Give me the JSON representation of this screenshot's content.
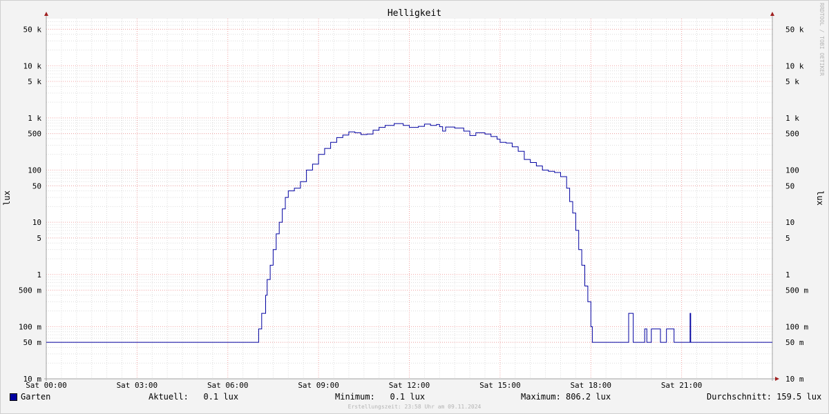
{
  "chart_data": {
    "type": "line",
    "title": "Helligkeit",
    "ylabel": "lux",
    "ylabel_right": "lux",
    "yscale": "log",
    "ylim": [
      0.01,
      80000
    ],
    "yticks": [
      {
        "value": 50000,
        "label": "50 k"
      },
      {
        "value": 10000,
        "label": "10 k"
      },
      {
        "value": 5000,
        "label": "5 k"
      },
      {
        "value": 1000,
        "label": "1 k"
      },
      {
        "value": 500,
        "label": "500"
      },
      {
        "value": 100,
        "label": "100"
      },
      {
        "value": 50,
        "label": "50"
      },
      {
        "value": 10,
        "label": "10"
      },
      {
        "value": 5,
        "label": "5"
      },
      {
        "value": 1,
        "label": "1"
      },
      {
        "value": 0.5,
        "label": "500 m"
      },
      {
        "value": 0.1,
        "label": "100 m"
      },
      {
        "value": 0.05,
        "label": "50 m"
      },
      {
        "value": 0.01,
        "label": "10 m"
      }
    ],
    "xlim_hours": [
      0,
      24
    ],
    "xticks": [
      {
        "hour": 0,
        "label": "Sat 00:00"
      },
      {
        "hour": 3,
        "label": "Sat 03:00"
      },
      {
        "hour": 6,
        "label": "Sat 06:00"
      },
      {
        "hour": 9,
        "label": "Sat 09:00"
      },
      {
        "hour": 12,
        "label": "Sat 12:00"
      },
      {
        "hour": 15,
        "label": "Sat 15:00"
      },
      {
        "hour": 18,
        "label": "Sat 18:00"
      },
      {
        "hour": 21,
        "label": "Sat 21:00"
      }
    ],
    "grid": true,
    "series": [
      {
        "name": "Garten",
        "color": "#0000a0",
        "points": [
          [
            0,
            0.05
          ],
          [
            7.0,
            0.05
          ],
          [
            7.02,
            0.09
          ],
          [
            7.1,
            0.09
          ],
          [
            7.12,
            0.18
          ],
          [
            7.2,
            0.18
          ],
          [
            7.25,
            0.4
          ],
          [
            7.3,
            0.8
          ],
          [
            7.4,
            1.5
          ],
          [
            7.5,
            3
          ],
          [
            7.6,
            6
          ],
          [
            7.7,
            10
          ],
          [
            7.8,
            18
          ],
          [
            7.9,
            30
          ],
          [
            8.0,
            40
          ],
          [
            8.2,
            45
          ],
          [
            8.4,
            60
          ],
          [
            8.6,
            100
          ],
          [
            8.8,
            130
          ],
          [
            9.0,
            200
          ],
          [
            9.2,
            260
          ],
          [
            9.4,
            340
          ],
          [
            9.6,
            420
          ],
          [
            9.8,
            470
          ],
          [
            10.0,
            540
          ],
          [
            10.2,
            520
          ],
          [
            10.4,
            480
          ],
          [
            10.6,
            490
          ],
          [
            10.8,
            580
          ],
          [
            11.0,
            660
          ],
          [
            11.2,
            720
          ],
          [
            11.5,
            780
          ],
          [
            11.8,
            720
          ],
          [
            12.0,
            660
          ],
          [
            12.3,
            690
          ],
          [
            12.5,
            760
          ],
          [
            12.7,
            720
          ],
          [
            12.9,
            750
          ],
          [
            13.0,
            680
          ],
          [
            13.1,
            560
          ],
          [
            13.2,
            670
          ],
          [
            13.5,
            640
          ],
          [
            13.8,
            560
          ],
          [
            14.0,
            460
          ],
          [
            14.2,
            520
          ],
          [
            14.5,
            490
          ],
          [
            14.7,
            440
          ],
          [
            14.9,
            390
          ],
          [
            15.0,
            340
          ],
          [
            15.2,
            330
          ],
          [
            15.4,
            280
          ],
          [
            15.6,
            230
          ],
          [
            15.8,
            160
          ],
          [
            16.0,
            140
          ],
          [
            16.2,
            120
          ],
          [
            16.4,
            100
          ],
          [
            16.6,
            95
          ],
          [
            16.8,
            90
          ],
          [
            17.0,
            75
          ],
          [
            17.2,
            45
          ],
          [
            17.3,
            25
          ],
          [
            17.4,
            15
          ],
          [
            17.5,
            7
          ],
          [
            17.6,
            3
          ],
          [
            17.7,
            1.5
          ],
          [
            17.8,
            0.6
          ],
          [
            17.9,
            0.3
          ],
          [
            18.0,
            0.1
          ],
          [
            18.05,
            0.05
          ],
          [
            19.2,
            0.05
          ],
          [
            19.25,
            0.18
          ],
          [
            19.35,
            0.18
          ],
          [
            19.4,
            0.05
          ],
          [
            19.75,
            0.05
          ],
          [
            19.78,
            0.09
          ],
          [
            19.82,
            0.09
          ],
          [
            19.85,
            0.05
          ],
          [
            19.95,
            0.05
          ],
          [
            20.0,
            0.09
          ],
          [
            20.25,
            0.09
          ],
          [
            20.3,
            0.05
          ],
          [
            20.45,
            0.05
          ],
          [
            20.5,
            0.09
          ],
          [
            20.7,
            0.09
          ],
          [
            20.75,
            0.05
          ],
          [
            21.25,
            0.05
          ],
          [
            21.28,
            0.18
          ],
          [
            21.3,
            0.05
          ],
          [
            24.0,
            0.05
          ]
        ]
      }
    ]
  },
  "legend": {
    "series_name": "Garten",
    "current": "Aktuell:   0.1 lux",
    "minimum": "Minimum:   0.1 lux",
    "maximum": "Maximum: 806.2 lux",
    "average": "Durchschnitt: 159.5 lux"
  },
  "watermark": "RRDTOOL / TOBI OETIKER",
  "footer": "Erstellungszeit: 23:58 Uhr am 09.11.2024"
}
